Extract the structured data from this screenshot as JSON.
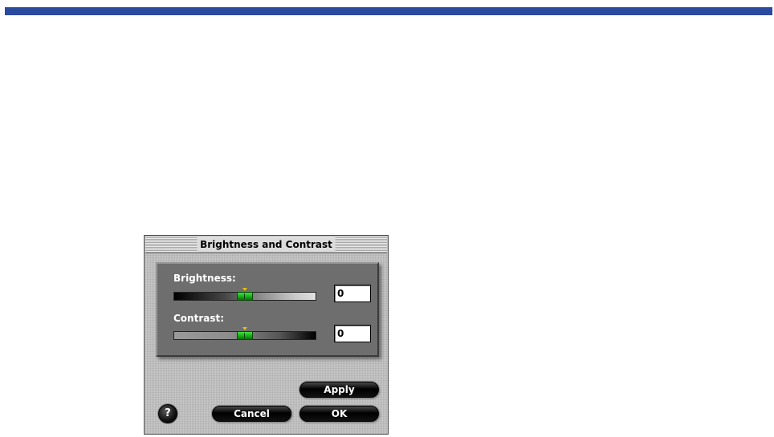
{
  "dialog": {
    "title": "Brightness and Contrast"
  },
  "brightness": {
    "label": "Brightness:",
    "value": "0",
    "slider_position": 0.5
  },
  "contrast": {
    "label": "Contrast:",
    "value": "0",
    "slider_position": 0.5
  },
  "buttons": {
    "apply": "Apply",
    "cancel": "Cancel",
    "ok": "OK",
    "help": "?"
  },
  "colors": {
    "top_stripe": "#2a4aa0",
    "slider_thumb": "#16a616",
    "pointer": "#e8c000"
  },
  "icons": {
    "help": "help-question-icon"
  }
}
